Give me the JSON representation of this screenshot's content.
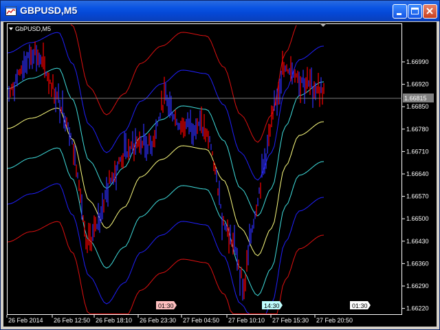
{
  "window": {
    "title": "GBPUSD,M5"
  },
  "chart": {
    "label": "GbPUSD,M5",
    "current_price": "1.66815",
    "price_ticks": [
      "1.66990",
      "1.66920",
      "1.66850",
      "1.66780",
      "1.66710",
      "1.66640",
      "1.66570",
      "1.66500",
      "1.66430",
      "1.66360",
      "1.66290",
      "1.66220"
    ],
    "time_ticks": [
      "26 Feb 2014",
      "26 Feb 12:50",
      "26 Feb 18:10",
      "26 Feb 23:30",
      "27 Feb 04:50",
      "27 Feb 10:10",
      "27 Feb 15:30",
      "27 Feb 20:50"
    ],
    "session_markers": [
      {
        "label": "01:30",
        "color": "#ffc0c0"
      },
      {
        "label": "14:30",
        "color": "#c0ffff"
      },
      {
        "label": "01:30",
        "color": "#ffffff"
      }
    ],
    "colors": {
      "background": "#000000",
      "candles": "#ff0000",
      "candles_alt": "#3030ff",
      "band_mid": "#ffff80",
      "band_1": "#40e0e0",
      "band_2": "#2020ff",
      "band_3": "#e01010",
      "price_line": "#808080",
      "axis": "#ffffff"
    },
    "icons": {
      "window": "chart-window-icon",
      "chart_menu": "triangle-down-icon",
      "shift": "triangle-down-icon"
    }
  }
}
